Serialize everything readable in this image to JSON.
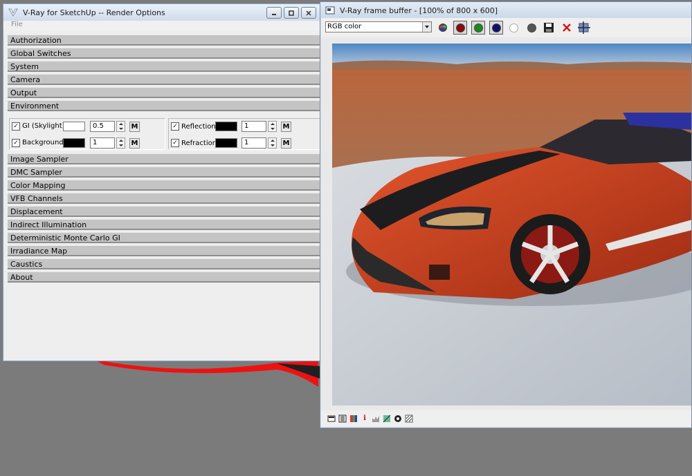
{
  "render_options": {
    "title": "V-Ray for SketchUp -- Render Options",
    "menu": [
      "File"
    ],
    "rollouts_top": [
      "Authorization",
      "Global Switches",
      "System",
      "Camera",
      "Output",
      "Environment"
    ],
    "environment": {
      "gi_label": "GI (Skylight)",
      "gi_value": "0.5",
      "gi_color": "#ffffff",
      "background_label": "Background",
      "background_value": "1",
      "background_color": "#000000",
      "reflection_label": "Reflection",
      "reflection_value": "1",
      "reflection_color": "#000000",
      "refraction_label": "Refraction",
      "refraction_value": "1",
      "refraction_color": "#000000",
      "map_button": "M",
      "checkbox_mark": "✓"
    },
    "rollouts_bottom": [
      "Image Sampler",
      "DMC Sampler",
      "Color Mapping",
      "VFB Channels",
      "Displacement",
      "Indirect Illumination",
      "Deterministic Monte Carlo GI",
      "Irradiance Map",
      "Caustics",
      "About"
    ]
  },
  "vfb": {
    "title": "V-Ray frame buffer - [100% of 800 x 600]",
    "channel_select": "RGB color",
    "toolbar_icons": [
      "rgb-channels-icon",
      "red-channel-icon",
      "green-channel-icon",
      "blue-channel-icon",
      "alpha-channel-icon",
      "monochrome-icon",
      "save-image-icon",
      "clear-image-icon",
      "track-mouse-icon"
    ],
    "status_icons": [
      "display-icon",
      "history-icon",
      "color-clamp-icon",
      "info-icon",
      "lut-icon",
      "levels-icon",
      "exposure-icon",
      "settings-icon"
    ],
    "info_glyph": "i"
  },
  "colors": {
    "accent_red": "#d01818",
    "title_text": "#1a1a1a"
  }
}
